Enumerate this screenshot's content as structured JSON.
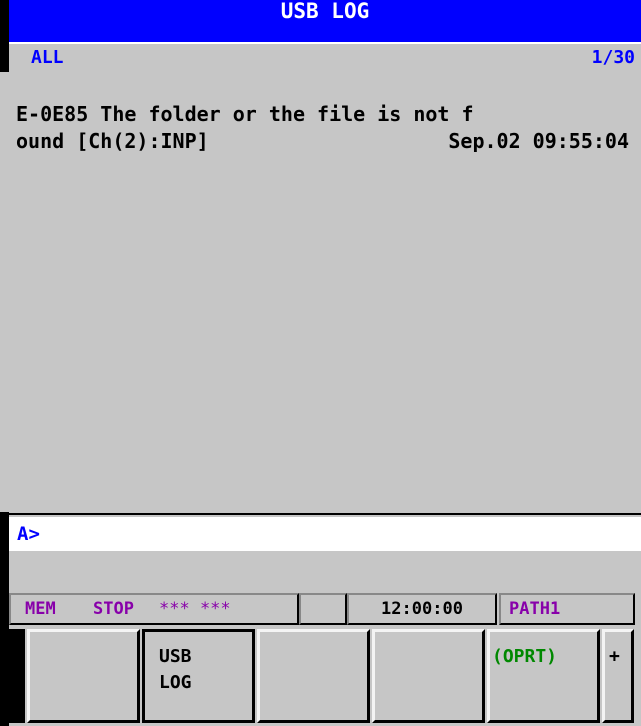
{
  "header": {
    "title": "USB LOG"
  },
  "subheader": {
    "filter": "ALL",
    "page": "1/30"
  },
  "log": {
    "entries": [
      {
        "line1": "E-0E85 The folder or the file is not f",
        "line2": "ound [Ch(2):INP]",
        "timestamp": "Sep.02 09:55:04"
      }
    ]
  },
  "input": {
    "prompt": "A>"
  },
  "status": {
    "mode": "MEM",
    "state": "STOP",
    "alarm": "*** ***",
    "blank": "",
    "time": "12:00:00",
    "path": "PATH1"
  },
  "softkeys": {
    "k1": "",
    "k2": "USB\nLOG",
    "k3": "",
    "k4": "",
    "k5": "(OPRT)",
    "k6": "+"
  },
  "colors": {
    "title_bg": "#0000ff",
    "screen_bg": "#c6c6c6",
    "status_text": "#8800aa",
    "oprt_text": "#008800"
  }
}
